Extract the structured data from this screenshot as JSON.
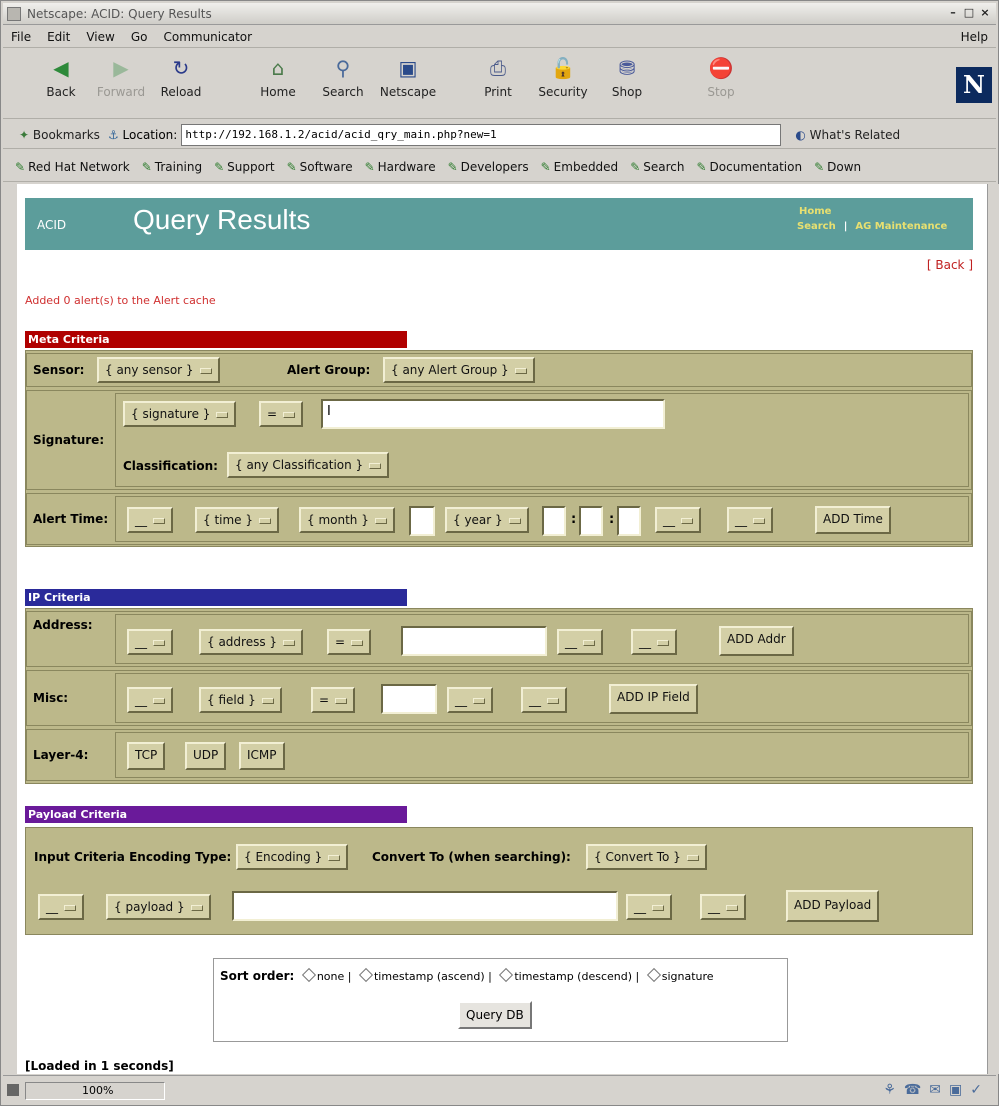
{
  "window": {
    "title": "Netscape: ACID: Query Results"
  },
  "menu": [
    "File",
    "Edit",
    "View",
    "Go",
    "Communicator"
  ],
  "menu_help": "Help",
  "toolbar": [
    {
      "label": "Back",
      "icon": "back-arrow"
    },
    {
      "label": "Forward",
      "icon": "forward-arrow"
    },
    {
      "label": "Reload",
      "icon": "reload"
    },
    {
      "label": "Home",
      "icon": "home"
    },
    {
      "label": "Search",
      "icon": "search"
    },
    {
      "label": "Netscape",
      "icon": "netscape"
    },
    {
      "label": "Print",
      "icon": "print"
    },
    {
      "label": "Security",
      "icon": "lock"
    },
    {
      "label": "Shop",
      "icon": "shop-bag"
    },
    {
      "label": "Stop",
      "icon": "stop"
    }
  ],
  "location": {
    "bookmarks": "Bookmarks",
    "label": "Location:",
    "url": "http://192.168.1.2/acid/acid_qry_main.php?new=1",
    "related": "What's Related"
  },
  "links": [
    "Red Hat Network",
    "Training",
    "Support",
    "Software",
    "Hardware",
    "Developers",
    "Embedded",
    "Search",
    "Documentation",
    "Down"
  ],
  "page": {
    "brand": "ACID",
    "title": "Query Results",
    "home_link": "Home",
    "search_link": "Search",
    "sep": "|",
    "maint_link": "AG Maintenance",
    "back_link": "[ Back ]",
    "added_msg": "Added 0 alert(s) to the Alert cache",
    "loaded": "[Loaded in 1 seconds]"
  },
  "meta": {
    "title": "Meta Criteria",
    "color": "#b00000",
    "sensor_label": "Sensor:",
    "sensor_value": "{ any sensor }",
    "alertgroup_label": "Alert Group:",
    "alertgroup_value": "{ any Alert Group }",
    "signature_label": "Signature:",
    "signature_select": "{ signature }",
    "signature_op": "=",
    "signature_text": "I",
    "classification_label": "Classification:",
    "classification_value": "{ any Classification }",
    "alerttime_label": "Alert Time:",
    "time_sel1": "__",
    "time_select": "{ time }",
    "month_select": "{ month }",
    "year_select": "{ year }",
    "time_sel_hh": "__",
    "time_sel_end": "__",
    "add_time": "ADD Time"
  },
  "ip": {
    "title": "IP Criteria",
    "color": "#2a2a9a",
    "address_label": "Address:",
    "addr_sel1": "__",
    "address_select": "{ address }",
    "addr_op": "=",
    "addr_sel2": "__",
    "addr_sel3": "__",
    "add_addr": "ADD Addr",
    "misc_label": "Misc:",
    "misc_sel1": "__",
    "field_select": "{ field }",
    "misc_op": "=",
    "misc_sel2": "__",
    "misc_sel3": "__",
    "add_ip_field": "ADD IP Field",
    "layer4_label": "Layer-4:",
    "tcp": "TCP",
    "udp": "UDP",
    "icmp": "ICMP"
  },
  "payload": {
    "title": "Payload Criteria",
    "color": "#6a1a9a",
    "enc_label": "Input Criteria Encoding Type:",
    "enc_value": "{ Encoding }",
    "convert_label": "Convert To (when searching):",
    "convert_value": "{ Convert To }",
    "sel1": "__",
    "payload_select": "{ payload }",
    "sel2": "__",
    "sel3": "__",
    "add_payload": "ADD Payload"
  },
  "sort": {
    "label": "Sort order:",
    "options": [
      "none |",
      "timestamp (ascend) |",
      "timestamp (descend) |",
      "signature"
    ],
    "query_button": "Query DB"
  },
  "status": {
    "zoom": "100%"
  }
}
